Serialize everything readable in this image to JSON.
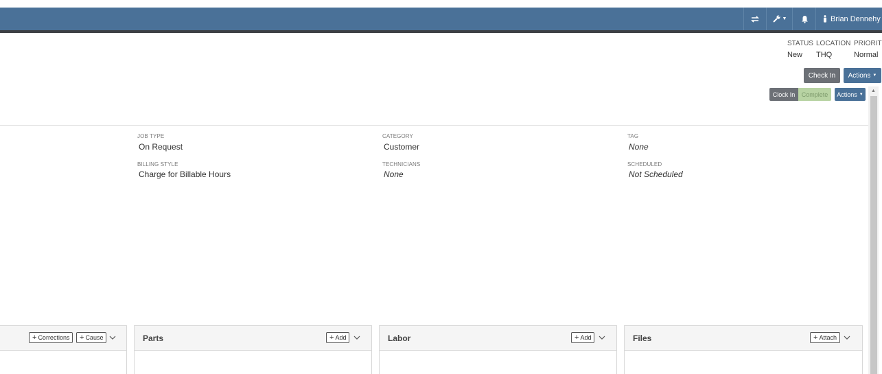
{
  "navbar": {
    "user_name": "Brian Dennehy",
    "icons": [
      "transfer-icon",
      "wrench-icon",
      "bell-icon",
      "user-icon"
    ],
    "accent_color": "#4a7198"
  },
  "status": {
    "status_label": "STATUS",
    "status_value": "New",
    "location_label": "LOCATION",
    "location_value": "THQ",
    "priority_label": "PRIORITY",
    "priority_value": "Normal"
  },
  "buttons": {
    "check_in": "Check In",
    "actions_top": "Actions",
    "clock_in": "Clock In",
    "complete": "Complete",
    "actions_secondary": "Actions"
  },
  "details": {
    "job_type_label": "JOB TYPE",
    "job_type_value": "On Request",
    "category_label": "CATEGORY",
    "category_value": "Customer",
    "tag_label": "TAG",
    "tag_value": "None",
    "billing_style_label": "BILLING STYLE",
    "billing_style_value": "Charge for Billable Hours",
    "technicians_label": "TECHNICIANS",
    "technicians_value": "None",
    "scheduled_label": "SCHEDULED",
    "scheduled_value": "Not Scheduled"
  },
  "panels": {
    "first": {
      "corrections_label": "Corrections",
      "cause_label": "Cause"
    },
    "parts": {
      "title": "Parts",
      "add_label": "Add"
    },
    "labor": {
      "title": "Labor",
      "add_label": "Add"
    },
    "files": {
      "title": "Files",
      "attach_label": "Attach"
    }
  }
}
